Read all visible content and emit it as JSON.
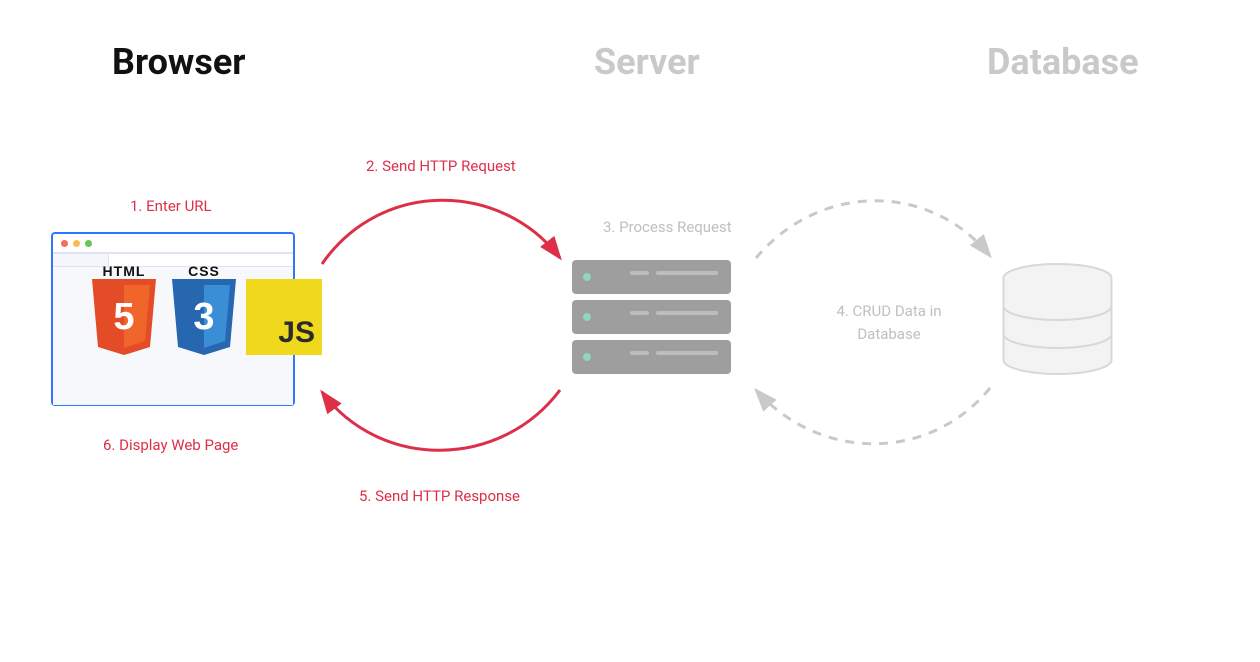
{
  "headings": {
    "browser": "Browser",
    "server": "Server",
    "database": "Database"
  },
  "steps": {
    "s1": "1. Enter URL",
    "s2": "2. Send HTTP Request",
    "s3": "3. Process Request",
    "s4": "4. CRUD Data\nin Database",
    "s5": "5. Send HTTP Response",
    "s6": "6. Display Web Page"
  },
  "tech": {
    "html": "HTML",
    "css": "CSS",
    "js": "JS",
    "html_glyph": "5",
    "css_glyph": "3"
  },
  "colors": {
    "accent": "#dc2f48",
    "faded": "#c9c9c9",
    "browser_border": "#2f76ff",
    "html_shield": "#e34c26",
    "css_shield": "#2767af",
    "js_bg": "#f0d91d"
  },
  "nodes": [
    {
      "id": "browser",
      "emphasized": true
    },
    {
      "id": "server",
      "emphasized": false
    },
    {
      "id": "database",
      "emphasized": false
    }
  ],
  "flows": [
    {
      "from": "browser",
      "to": "server",
      "top_label_step": 2,
      "bottom_label_step": 5,
      "active": true
    },
    {
      "from": "server",
      "to": "database",
      "top_label_step": 3,
      "bottom_label_step": null,
      "active": false
    }
  ]
}
